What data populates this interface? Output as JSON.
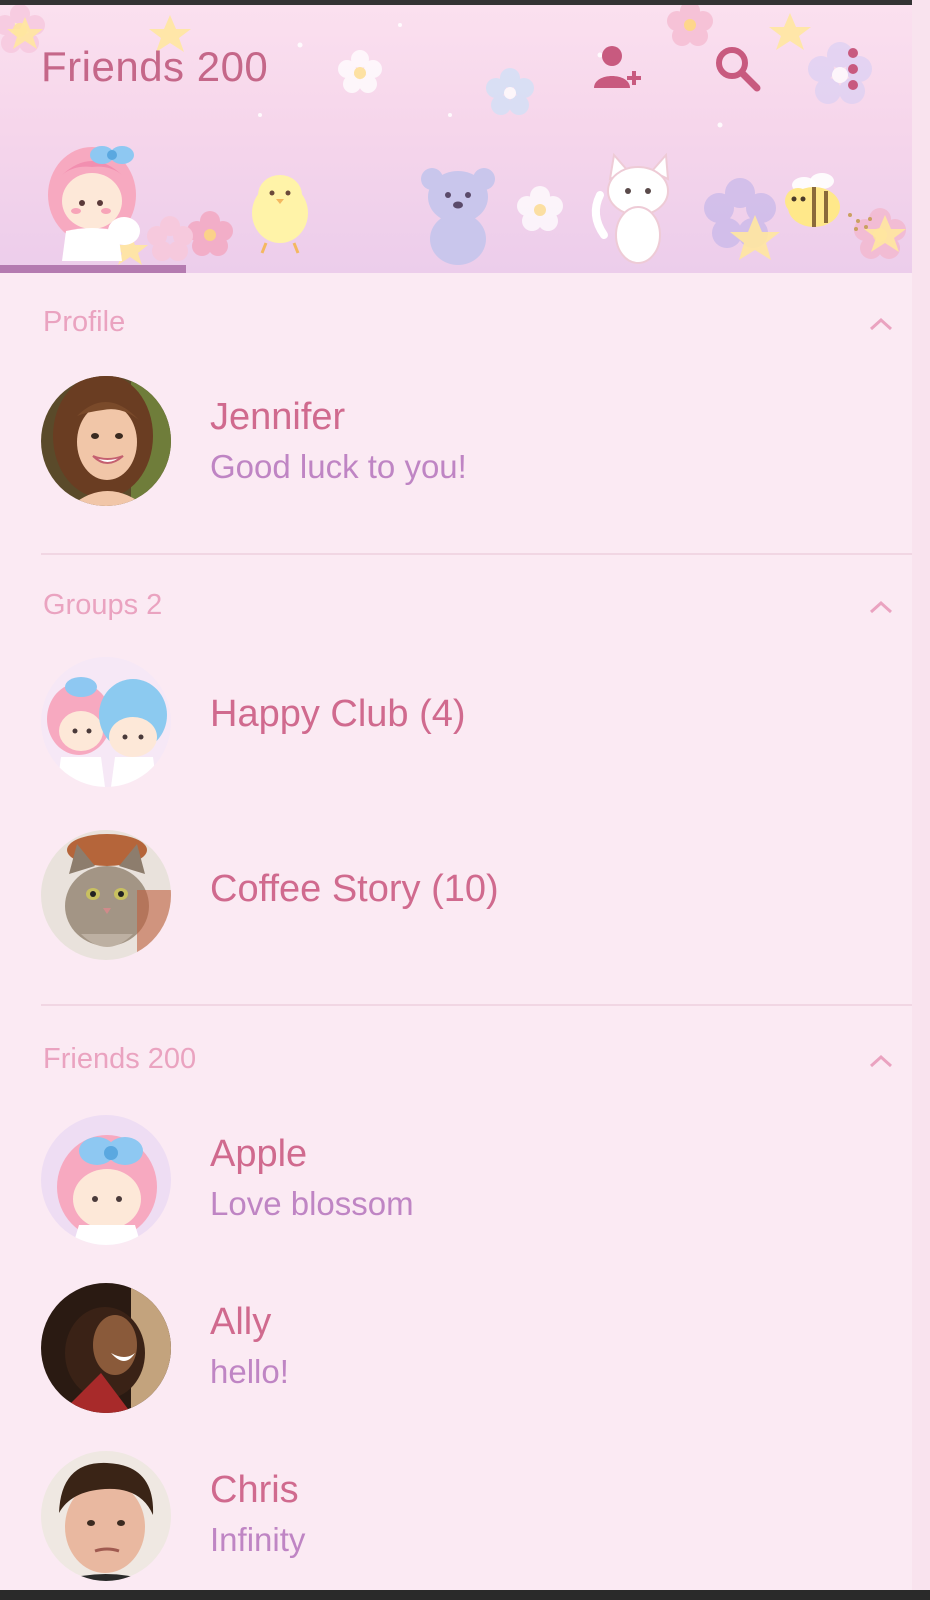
{
  "header": {
    "title": "Friends 200",
    "icons": [
      "add-friend-icon",
      "search-icon",
      "more-vert-icon"
    ],
    "tabs": [
      "tab-character-girl",
      "tab-character-chick",
      "tab-character-bear",
      "tab-character-cat",
      "tab-character-bee"
    ]
  },
  "sections": {
    "profile": {
      "title": "Profile",
      "item": {
        "name": "Jennifer",
        "status": "Good luck to you!"
      }
    },
    "groups": {
      "title": "Groups 2",
      "items": [
        {
          "name": "Happy Club (4)"
        },
        {
          "name": "Coffee Story (10)"
        }
      ]
    },
    "friends": {
      "title": "Friends 200",
      "items": [
        {
          "name": "Apple",
          "status": "Love blossom"
        },
        {
          "name": "Ally",
          "status": "hello!"
        },
        {
          "name": "Chris",
          "status": "Infinity"
        }
      ]
    }
  },
  "colors": {
    "background": "#fbeaf3",
    "title": "#c56789",
    "section": "#eaa3c0",
    "name": "#d06a8e",
    "status": "#bf85c4",
    "indicator": "#b47bb0"
  }
}
